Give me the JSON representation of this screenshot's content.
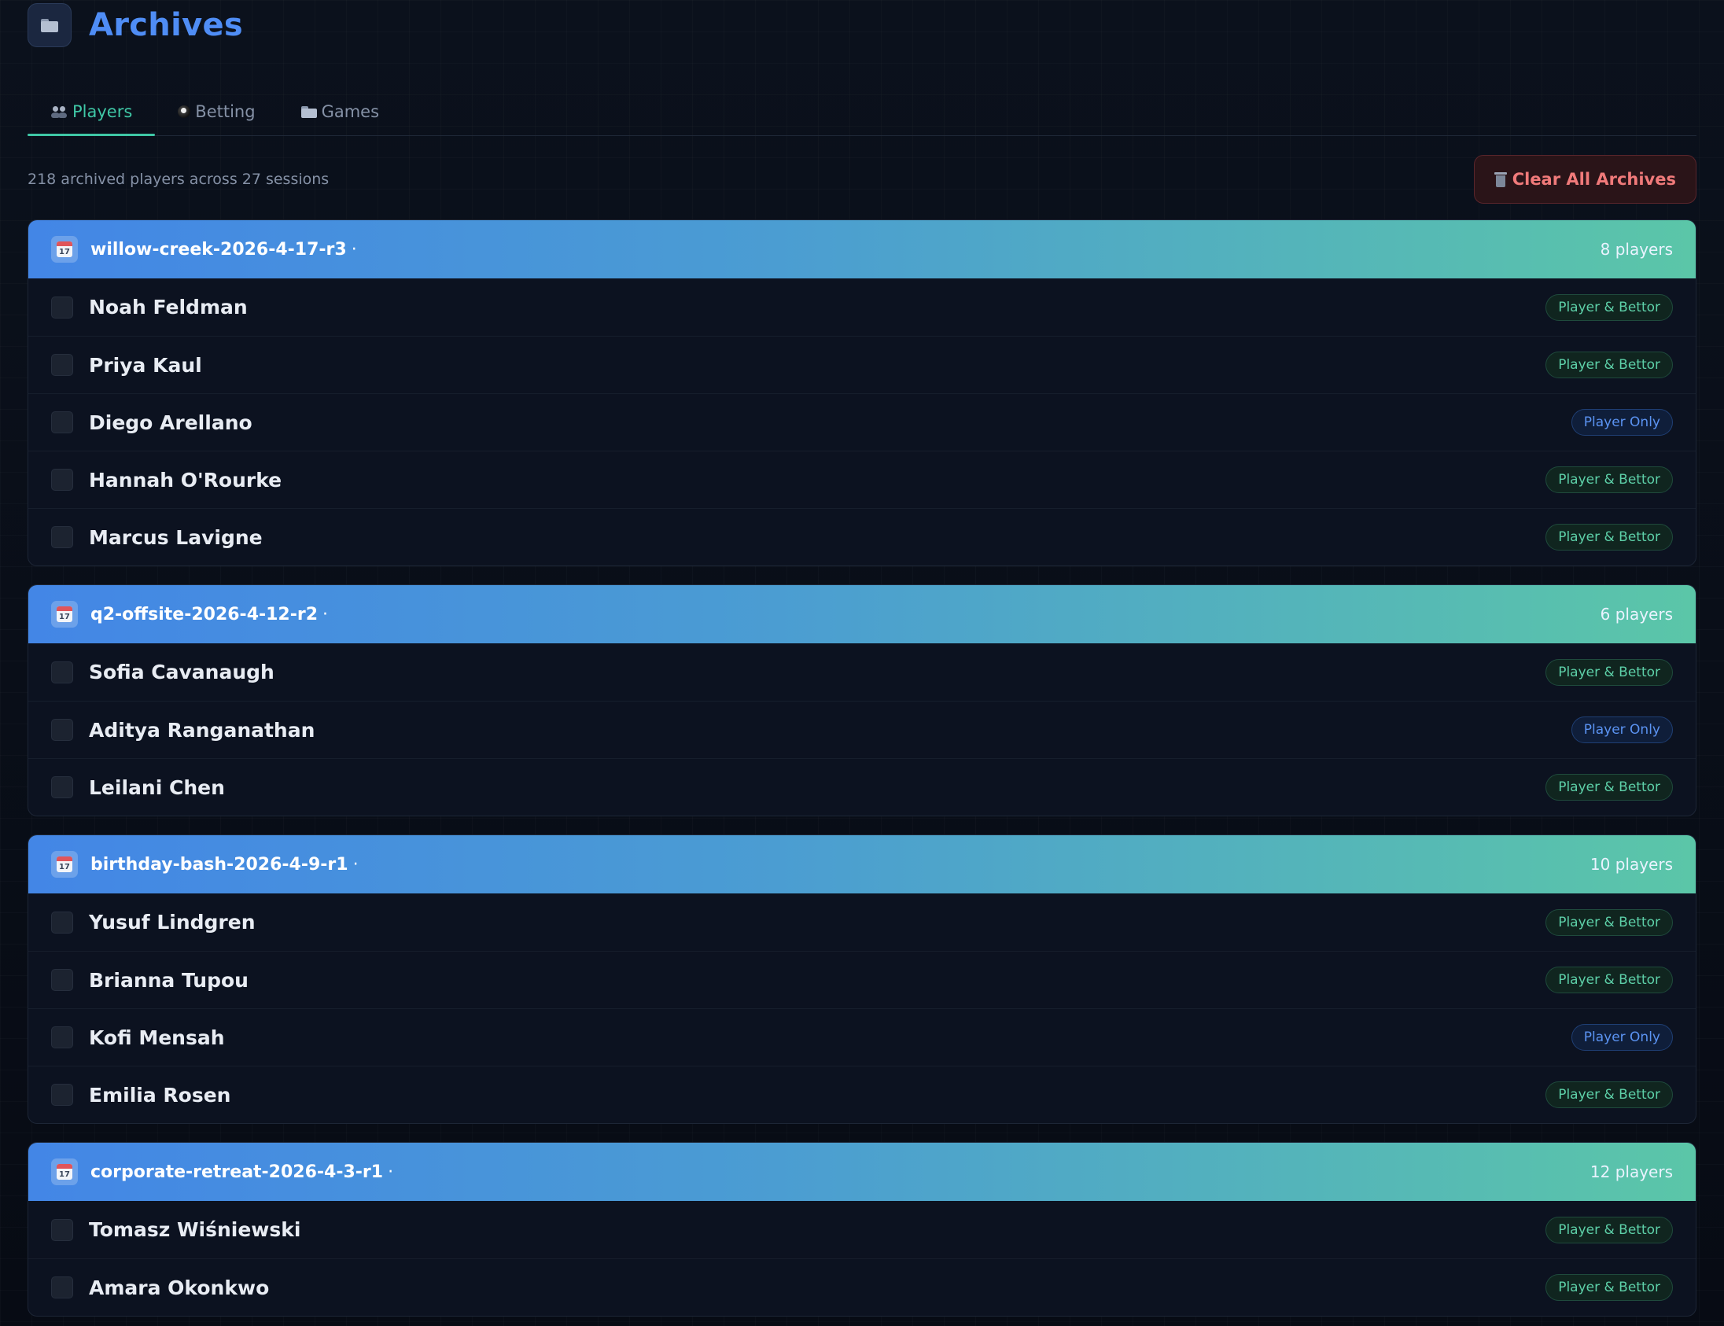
{
  "header": {
    "title": "Archives",
    "icon": "folder-icon"
  },
  "tabs": [
    {
      "label": "Players",
      "icon": "people-icon",
      "active": true
    },
    {
      "label": "Betting",
      "icon": "billiard-ball-icon",
      "active": false
    },
    {
      "label": "Games",
      "icon": "folder-icon",
      "active": false
    }
  ],
  "summary": {
    "text": "218 archived players across 27 sessions",
    "clear_button_label": "Clear All Archives"
  },
  "colors": {
    "accent_blue": "#4f8df5",
    "accent_teal": "#3fc7a6",
    "danger": "#f07a7a",
    "badge_player_bettor": "#5dd0a8",
    "badge_player_only": "#5b93f2"
  },
  "sessions": [
    {
      "name": "willow-creek-2026-4-17-r3",
      "separator": "·",
      "count_label": "8 players",
      "players": [
        {
          "name": "Noah Feldman",
          "badge": "Player & Bettor",
          "type": "pb"
        },
        {
          "name": "Priya Kaul",
          "badge": "Player & Bettor",
          "type": "pb"
        },
        {
          "name": "Diego Arellano",
          "badge": "Player Only",
          "type": "po"
        },
        {
          "name": "Hannah O'Rourke",
          "badge": "Player & Bettor",
          "type": "pb"
        },
        {
          "name": "Marcus Lavigne",
          "badge": "Player & Bettor",
          "type": "pb"
        }
      ]
    },
    {
      "name": "q2-offsite-2026-4-12-r2",
      "separator": "·",
      "count_label": "6 players",
      "players": [
        {
          "name": "Sofia Cavanaugh",
          "badge": "Player & Bettor",
          "type": "pb"
        },
        {
          "name": "Aditya Ranganathan",
          "badge": "Player Only",
          "type": "po"
        },
        {
          "name": "Leilani Chen",
          "badge": "Player & Bettor",
          "type": "pb"
        }
      ]
    },
    {
      "name": "birthday-bash-2026-4-9-r1",
      "separator": "·",
      "count_label": "10 players",
      "players": [
        {
          "name": "Yusuf Lindgren",
          "badge": "Player & Bettor",
          "type": "pb"
        },
        {
          "name": "Brianna Tupou",
          "badge": "Player & Bettor",
          "type": "pb"
        },
        {
          "name": "Kofi Mensah",
          "badge": "Player Only",
          "type": "po"
        },
        {
          "name": "Emilia Rosen",
          "badge": "Player & Bettor",
          "type": "pb"
        }
      ]
    },
    {
      "name": "corporate-retreat-2026-4-3-r1",
      "separator": "·",
      "count_label": "12 players",
      "players": [
        {
          "name": "Tomasz Wiśniewski",
          "badge": "Player & Bettor",
          "type": "pb"
        },
        {
          "name": "Amara Okonkwo",
          "badge": "Player & Bettor",
          "type": "pb"
        }
      ]
    }
  ]
}
